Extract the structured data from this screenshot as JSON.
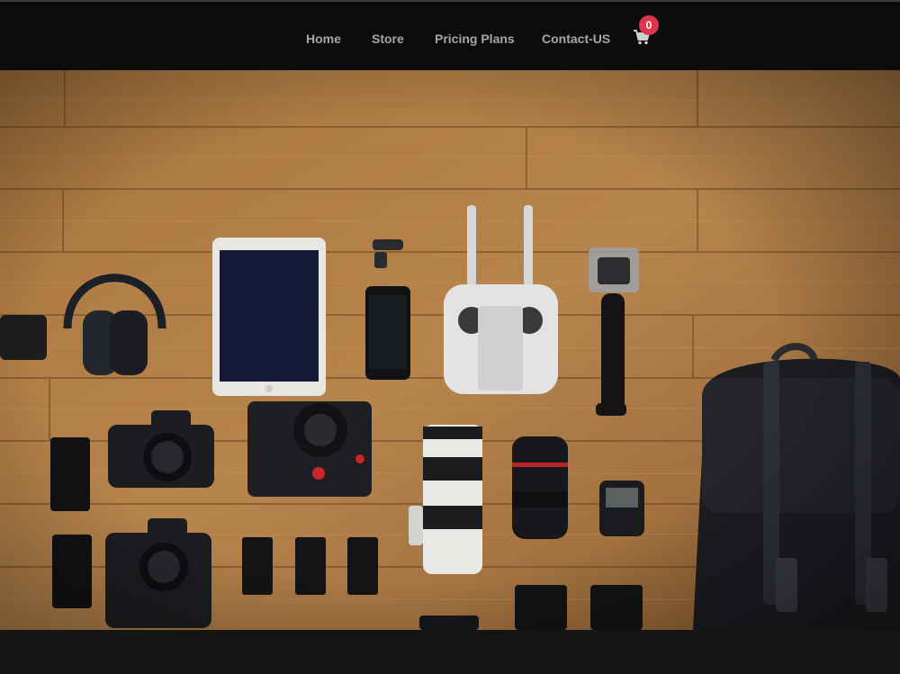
{
  "nav": {
    "items": [
      {
        "label": "Home"
      },
      {
        "label": "Store"
      },
      {
        "label": "Pricing Plans"
      },
      {
        "label": "Contact-US"
      }
    ],
    "cart": {
      "icon": "cart-icon",
      "count": "0"
    }
  },
  "hero": {
    "description": "photo",
    "items": [
      "wooden-table",
      "camera",
      "tablet",
      "phone",
      "headphones",
      "drone-controller",
      "action-camera",
      "camera-lenses",
      "batteries",
      "backpack"
    ]
  },
  "colors": {
    "nav_bg": "#0c0c0d",
    "nav_text": "#a6a6a6",
    "badge": "#e0354c",
    "wood": "#b07d45",
    "footer": "#151515"
  }
}
